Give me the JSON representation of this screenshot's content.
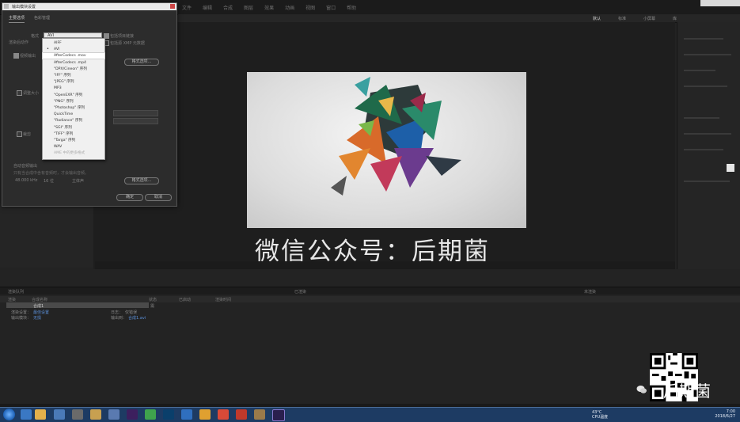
{
  "app": {
    "menu": [
      "文件",
      "编辑",
      "合成",
      "图层",
      "效果",
      "动画",
      "视图",
      "窗口",
      "帮助"
    ],
    "workspaces": [
      "默认",
      "标准",
      "小屏幕",
      "库"
    ],
    "active_workspace": "默认"
  },
  "dialog": {
    "title": "输出模块设置",
    "tabs": [
      "主要选项",
      "色彩管理"
    ],
    "active_tab": "主要选项",
    "format_label": "格式",
    "format_value": "AVI",
    "post_render_label": "渲染后动作",
    "include_project_link": "包括项目链接",
    "include_xmp": "包括源 XMP 元数据",
    "video_output": "视频输出",
    "format_options_button": "格式选项...",
    "resize": "调整大小",
    "crop": "裁剪",
    "audio_output": "自动音频输出",
    "audio_note": "只有当合成中含有音频时，才会输出音频。",
    "audio_rate": "48.000 kHz",
    "audio_depth": "16 位",
    "audio_channels": "立体声",
    "audio_options_button": "格式选项...",
    "ok_button": "确定",
    "cancel_button": "取消",
    "dropdown_options": [
      {
        "label": "AIFF",
        "checked": false,
        "highlight": false,
        "dim": false
      },
      {
        "label": "AVI",
        "checked": true,
        "highlight": false,
        "dim": false
      },
      {
        "label": "AfterCodecs .mov",
        "checked": false,
        "highlight": true,
        "dim": false
      },
      {
        "label": "AfterCodecs .mp4",
        "checked": false,
        "highlight": false,
        "dim": false
      },
      {
        "label": "\"DPX/Cineon\" 序列",
        "checked": false,
        "highlight": false,
        "dim": false
      },
      {
        "label": "\"IFF\" 序列",
        "checked": false,
        "highlight": false,
        "dim": false
      },
      {
        "label": "\"JPEG\" 序列",
        "checked": false,
        "highlight": false,
        "dim": false
      },
      {
        "label": "MP3",
        "checked": false,
        "highlight": false,
        "dim": false
      },
      {
        "label": "\"OpenEXR\" 序列",
        "checked": false,
        "highlight": false,
        "dim": false
      },
      {
        "label": "\"PNG\" 序列",
        "checked": false,
        "highlight": false,
        "dim": false
      },
      {
        "label": "\"Photoshop\" 序列",
        "checked": false,
        "highlight": false,
        "dim": false
      },
      {
        "label": "QuickTime",
        "checked": false,
        "highlight": false,
        "dim": false
      },
      {
        "label": "\"Radiance\" 序列",
        "checked": false,
        "highlight": false,
        "dim": false
      },
      {
        "label": "\"SGI\" 序列",
        "checked": false,
        "highlight": false,
        "dim": false
      },
      {
        "label": "\"TIFF\" 序列",
        "checked": false,
        "highlight": false,
        "dim": false
      },
      {
        "label": "\"Targa\" 序列",
        "checked": false,
        "highlight": false,
        "dim": false
      },
      {
        "label": "WAV",
        "checked": false,
        "highlight": false,
        "dim": false
      },
      {
        "label": "AME 中的更多格式",
        "checked": false,
        "highlight": false,
        "dim": true
      }
    ]
  },
  "viewer": {
    "caption": "微信公众号：后期菌"
  },
  "render_queue": {
    "tabs": [
      "渲染队列",
      "已渲染",
      "未渲染"
    ],
    "columns": [
      "渲染",
      "合成名称",
      "状态",
      "已启动",
      "渲染时间"
    ],
    "row": {
      "comp": "合成1",
      "status": "需要输出"
    },
    "render_settings_label": "渲染设置：",
    "render_settings_value": "最佳设置",
    "output_module_label": "输出模块：",
    "output_module_value": "无损",
    "log_label": "日志：",
    "log_value": "仅错误",
    "output_to_label": "输出到：",
    "output_to_value": "合成1.avi"
  },
  "overlay": {
    "watermark": "后期菌"
  },
  "taskbar": {
    "weather_temp": "43°C",
    "weather_label": "CPU温度",
    "clock_time": "7:00",
    "clock_date": "2018/6/27"
  }
}
